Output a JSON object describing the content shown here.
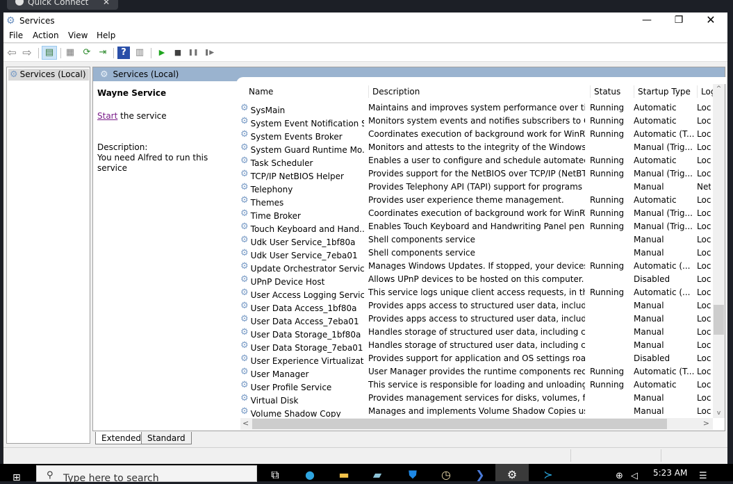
{
  "quick_connect": {
    "label": "Quick Connect",
    "close": "✕"
  },
  "window": {
    "title": "Services",
    "controls": {
      "minimize": "—",
      "maximize": "❐",
      "close": "✕"
    }
  },
  "menu": [
    "File",
    "Action",
    "View",
    "Help"
  ],
  "toolbar": {
    "buttons": [
      {
        "name": "back",
        "glyph": "⇦"
      },
      {
        "name": "forward",
        "glyph": "⇨"
      },
      {
        "name": "show-hide-console-tree",
        "glyph": "▤"
      },
      {
        "name": "properties",
        "glyph": "▦"
      },
      {
        "name": "refresh",
        "glyph": "⟳"
      },
      {
        "name": "export-list",
        "glyph": "⇥"
      },
      {
        "name": "help",
        "glyph": "?"
      },
      {
        "name": "show-action-pane",
        "glyph": "▥"
      },
      {
        "name": "start-service",
        "glyph": "▶"
      },
      {
        "name": "stop-service",
        "glyph": "■"
      },
      {
        "name": "pause-service",
        "glyph": "❚❚"
      },
      {
        "name": "restart-service",
        "glyph": "❚▶"
      }
    ]
  },
  "tree": {
    "item": "Services (Local)"
  },
  "main": {
    "header": "Services (Local)",
    "selected_service": "Wayne Service",
    "start_link": "Start",
    "start_suffix": " the service",
    "description_label": "Description:",
    "description": "You need Alfred to run this service"
  },
  "table": {
    "columns": [
      "Name",
      "Description",
      "Status",
      "Startup Type",
      "Log"
    ],
    "sort_indicator": "^",
    "rows": [
      {
        "name": "SysMain",
        "description": "Maintains and improves system performance over time.",
        "status": "Running",
        "startup": "Automatic",
        "log": "Loc"
      },
      {
        "name": "System Event Notification S...",
        "description": "Monitors system events and notifies subscribers to COM...",
        "status": "Running",
        "startup": "Automatic",
        "log": "Loc"
      },
      {
        "name": "System Events Broker",
        "description": "Coordinates execution of background work for WinRT a...",
        "status": "Running",
        "startup": "Automatic (T...",
        "log": "Loc"
      },
      {
        "name": "System Guard Runtime Mo...",
        "description": "Monitors and attests to the integrity of the Windows plat...",
        "status": "",
        "startup": "Manual (Trig...",
        "log": "Loc"
      },
      {
        "name": "Task Scheduler",
        "description": "Enables a user to configure and schedule automated tas...",
        "status": "Running",
        "startup": "Automatic",
        "log": "Loc"
      },
      {
        "name": "TCP/IP NetBIOS Helper",
        "description": "Provides support for the NetBIOS over TCP/IP (NetBT) ser...",
        "status": "Running",
        "startup": "Manual (Trig...",
        "log": "Loc"
      },
      {
        "name": "Telephony",
        "description": "Provides Telephony API (TAPI) support for programs that...",
        "status": "",
        "startup": "Manual",
        "log": "Net"
      },
      {
        "name": "Themes",
        "description": "Provides user experience theme management.",
        "status": "Running",
        "startup": "Automatic",
        "log": "Loc"
      },
      {
        "name": "Time Broker",
        "description": "Coordinates execution of background work for WinRT a...",
        "status": "Running",
        "startup": "Manual (Trig...",
        "log": "Loc"
      },
      {
        "name": "Touch Keyboard and Hand...",
        "description": "Enables Touch Keyboard and Handwriting Panel pen and...",
        "status": "Running",
        "startup": "Manual (Trig...",
        "log": "Loc"
      },
      {
        "name": "Udk User Service_1bf80a",
        "description": "Shell components service",
        "status": "",
        "startup": "Manual",
        "log": "Loc"
      },
      {
        "name": "Udk User Service_7eba01",
        "description": "Shell components service",
        "status": "",
        "startup": "Manual",
        "log": "Loc"
      },
      {
        "name": "Update Orchestrator Service",
        "description": "Manages Windows Updates. If stopped, your devices will...",
        "status": "Running",
        "startup": "Automatic (...",
        "log": "Loc"
      },
      {
        "name": "UPnP Device Host",
        "description": "Allows UPnP devices to be hosted on this computer. If t...",
        "status": "",
        "startup": "Disabled",
        "log": "Loc"
      },
      {
        "name": "User Access Logging Service",
        "description": "This service logs unique client access requests, in the for...",
        "status": "Running",
        "startup": "Automatic (...",
        "log": "Loc"
      },
      {
        "name": "User Data Access_1bf80a",
        "description": "Provides apps access to structured user data, including c...",
        "status": "",
        "startup": "Manual",
        "log": "Loc"
      },
      {
        "name": "User Data Access_7eba01",
        "description": "Provides apps access to structured user data, including c...",
        "status": "",
        "startup": "Manual",
        "log": "Loc"
      },
      {
        "name": "User Data Storage_1bf80a",
        "description": "Handles storage of structured user data, including conta...",
        "status": "",
        "startup": "Manual",
        "log": "Loc"
      },
      {
        "name": "User Data Storage_7eba01",
        "description": "Handles storage of structured user data, including conta...",
        "status": "",
        "startup": "Manual",
        "log": "Loc"
      },
      {
        "name": "User Experience Virtualizati...",
        "description": "Provides support for application and OS settings roaming",
        "status": "",
        "startup": "Disabled",
        "log": "Loc"
      },
      {
        "name": "User Manager",
        "description": "User Manager provides the runtime components require...",
        "status": "Running",
        "startup": "Automatic (T...",
        "log": "Loc"
      },
      {
        "name": "User Profile Service",
        "description": "This service is responsible for loading and unloading use...",
        "status": "Running",
        "startup": "Automatic",
        "log": "Loc"
      },
      {
        "name": "Virtual Disk",
        "description": "Provides management services for disks, volumes, file sy...",
        "status": "",
        "startup": "Manual",
        "log": "Loc"
      },
      {
        "name": "Volume Shadow Copy",
        "description": "Manages and implements Volume Shadow Copies used ...",
        "status": "",
        "startup": "Manual",
        "log": "Loc"
      }
    ]
  },
  "scroll": {
    "up": "^",
    "down": "v",
    "left": "<",
    "right": ">"
  },
  "view_tabs": [
    "Extended",
    "Standard"
  ],
  "taskbar": {
    "search_placeholder": "Type here to search",
    "clock": "5:23 AM"
  }
}
